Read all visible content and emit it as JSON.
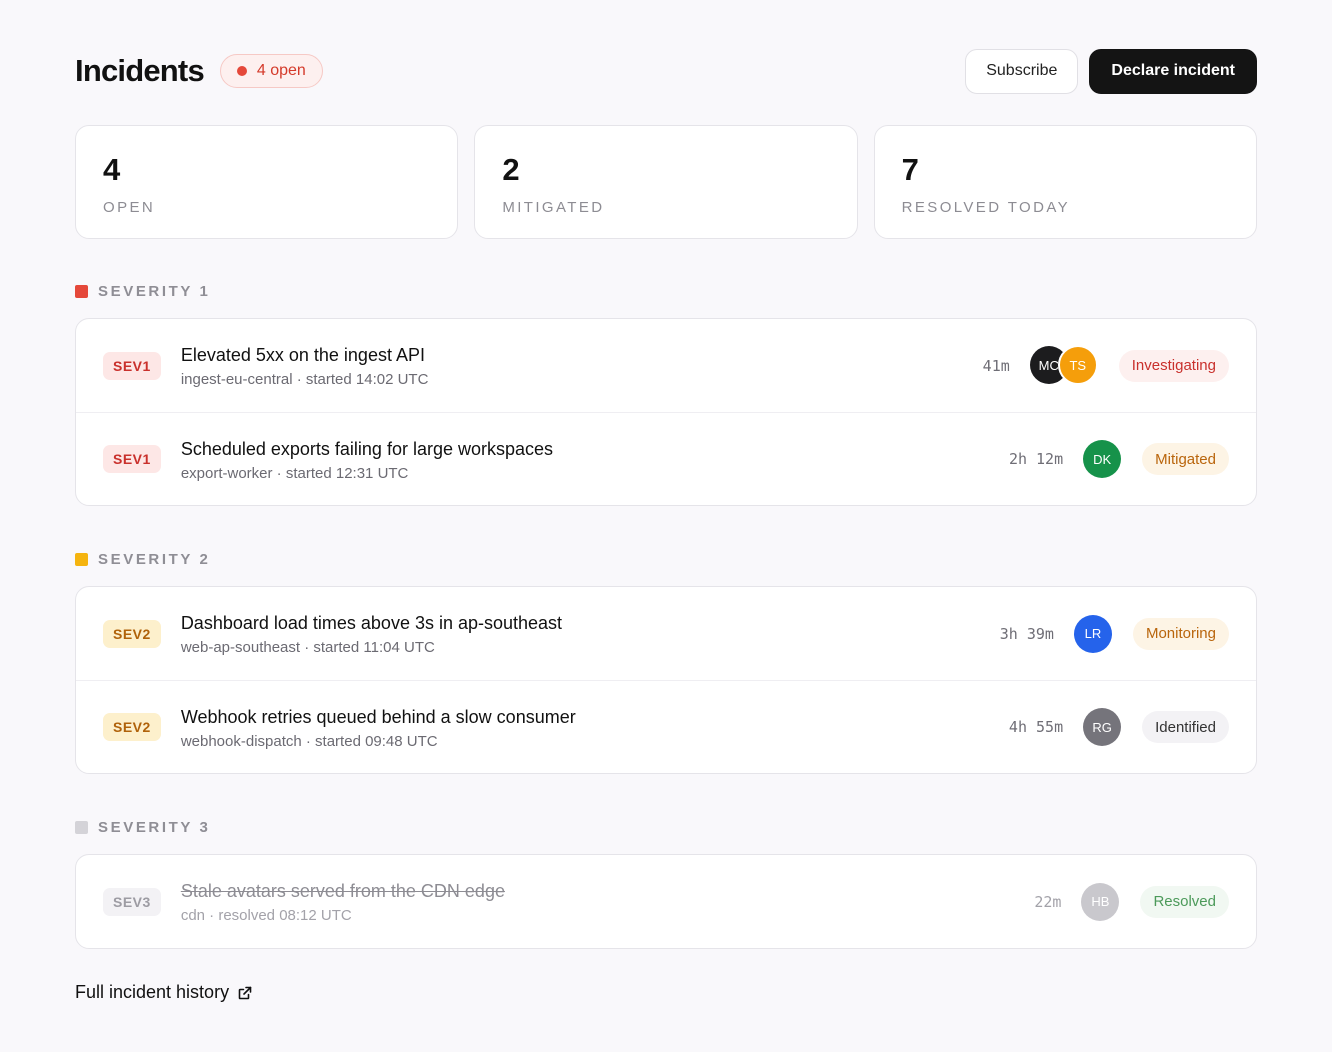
{
  "header": {
    "title": "Incidents",
    "open_badge": "4 open",
    "subscribe_label": "Subscribe",
    "declare_label": "Declare incident"
  },
  "stats": [
    {
      "value": "4",
      "label": "OPEN"
    },
    {
      "value": "2",
      "label": "MITIGATED"
    },
    {
      "value": "7",
      "label": "RESOLVED TODAY"
    }
  ],
  "sections": [
    {
      "label": "SEVERITY 1",
      "color": "#e5483a",
      "incidents": [
        {
          "sev": "SEV1",
          "title": "Elevated 5xx on the ingest API",
          "meta": "ingest-eu-central · started 14:02 UTC",
          "duration": "41m",
          "avatars": [
            {
              "initials": "MC",
              "color": "#1c1c1e"
            },
            {
              "initials": "TS",
              "color": "#f59e0b"
            }
          ],
          "status": "Investigating"
        },
        {
          "sev": "SEV1",
          "title": "Scheduled exports failing for large workspaces",
          "meta": "export-worker · started 12:31 UTC",
          "duration": "2h 12m",
          "avatars": [
            {
              "initials": "DK",
              "color": "#16924a"
            }
          ],
          "status": "Mitigated"
        }
      ]
    },
    {
      "label": "SEVERITY 2",
      "color": "#f5b40f",
      "incidents": [
        {
          "sev": "SEV2",
          "title": "Dashboard load times above 3s in ap-southeast",
          "meta": "web-ap-southeast · started 11:04 UTC",
          "duration": "3h 39m",
          "avatars": [
            {
              "initials": "LR",
              "color": "#2563eb"
            }
          ],
          "status": "Monitoring"
        },
        {
          "sev": "SEV2",
          "title": "Webhook retries queued behind a slow consumer",
          "meta": "webhook-dispatch · started 09:48 UTC",
          "duration": "4h 55m",
          "avatars": [
            {
              "initials": "RG",
              "color": "#75747b"
            }
          ],
          "status": "Identified"
        }
      ]
    },
    {
      "label": "SEVERITY 3",
      "color": "#d4d3d8",
      "incidents": [
        {
          "sev": "SEV3",
          "title": "Stale avatars served from the CDN edge",
          "meta": "cdn · resolved 08:12 UTC",
          "duration": "22m",
          "avatars": [
            {
              "initials": "HB",
              "color": "#c9c8cd"
            }
          ],
          "status": "Resolved"
        }
      ]
    }
  ],
  "footer": {
    "history_label": "Full incident history",
    "history_icon": "external-link-icon"
  }
}
